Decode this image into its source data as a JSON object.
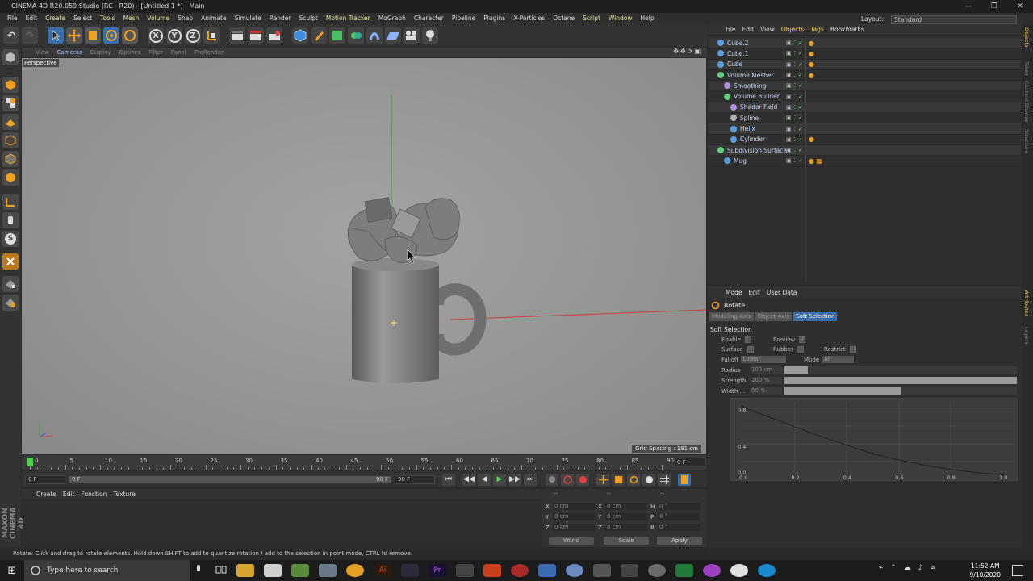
{
  "window": {
    "title": "CINEMA 4D R20.059 Studio (RC - R20) - [Untitled 1 *] - Main",
    "controls": [
      "—",
      "❐",
      "✕"
    ]
  },
  "menubar": {
    "items": [
      "File",
      "Edit",
      "Create",
      "Select",
      "Tools",
      "Mesh",
      "Volume",
      "Snap",
      "Animate",
      "Simulate",
      "Render",
      "Sculpt",
      "Motion Tracker",
      "MoGraph",
      "Character",
      "Pipeline",
      "Plugins",
      "X-Particles",
      "Octane",
      "Script",
      "Window",
      "Help"
    ],
    "highlighted": [
      "Create",
      "Tools",
      "Mesh",
      "Volume",
      "Motion Tracker",
      "Script",
      "Window"
    ],
    "layout_label": "Layout:",
    "layout_value": "Standard"
  },
  "toolbar": {
    "undo_icon": "↶",
    "redo_icon": "↷",
    "x_label": "X",
    "y_label": "Y",
    "z_label": "Z"
  },
  "viewport": {
    "menu": [
      "View",
      "Cameras",
      "Display",
      "Options",
      "Filter",
      "Panel",
      "ProRender"
    ],
    "active_menu": "Cameras",
    "camera_label": "Perspective",
    "grid_spacing": "Grid Spacing : 191 cm",
    "nav_icons": "✥✥⟳▣",
    "accent_background": "#959595"
  },
  "timeline": {
    "ticks": [
      "0",
      "5",
      "10",
      "15",
      "20",
      "25",
      "30",
      "35",
      "40",
      "45",
      "50",
      "55",
      "60",
      "65",
      "70",
      "75",
      "80",
      "85",
      "90"
    ],
    "current_frame_field": "0 F"
  },
  "transport": {
    "start_field": "0 F",
    "slider_start": "0 F",
    "slider_end": "90 F",
    "end_field": "90 F",
    "buttons": [
      "⏮",
      "◀◀",
      "◀",
      "▶",
      "▶▶",
      "⏭"
    ]
  },
  "material_panel": {
    "menu": [
      "Create",
      "Edit",
      "Function",
      "Texture"
    ]
  },
  "coordinates": {
    "headers": [
      "--",
      "--",
      "--"
    ],
    "rows": [
      {
        "a": "X",
        "a_val": "0 cm",
        "b": "X",
        "b_val": "0 cm",
        "c": "H",
        "c_val": "0 °"
      },
      {
        "a": "Y",
        "a_val": "0 cm",
        "b": "Y",
        "b_val": "0 cm",
        "c": "P",
        "c_val": "0 °"
      },
      {
        "a": "Z",
        "a_val": "0 cm",
        "b": "Z",
        "b_val": "0 cm",
        "c": "B",
        "c_val": "0 °"
      }
    ],
    "world_label": "World",
    "scale_label": "Scale",
    "apply_label": "Apply"
  },
  "status": {
    "text": "Rotate: Click and drag to rotate elements. Hold down SHIFT to add to quantize rotation / add to the selection in point mode, CTRL to remove."
  },
  "object_manager": {
    "menu": [
      "File",
      "Edit",
      "View",
      "Objects",
      "Tags",
      "Bookmarks"
    ],
    "objects": [
      {
        "name": "Cube.2",
        "indent": 0,
        "color": "#5aa0e0",
        "tag": "●"
      },
      {
        "name": "Cube.1",
        "indent": 0,
        "color": "#5aa0e0",
        "tag": "●"
      },
      {
        "name": "Cube",
        "indent": 0,
        "color": "#5aa0e0",
        "tag": "●"
      },
      {
        "name": "Volume Mesher",
        "indent": 0,
        "color": "#60d080",
        "tag": "●"
      },
      {
        "name": "Smoothing",
        "indent": 1,
        "color": "#b090e0",
        "tag": ""
      },
      {
        "name": "Volume Builder",
        "indent": 1,
        "color": "#60d080",
        "tag": ""
      },
      {
        "name": "Shader Field",
        "indent": 2,
        "color": "#b090e0",
        "tag": ""
      },
      {
        "name": "Spline",
        "indent": 2,
        "color": "#aaaaaa",
        "tag": ""
      },
      {
        "name": "Helix",
        "indent": 2,
        "color": "#5aa0e0",
        "tag": ""
      },
      {
        "name": "Cylinder",
        "indent": 2,
        "color": "#5aa0e0",
        "tag": "●"
      },
      {
        "name": "Subdivision Surface",
        "indent": 0,
        "color": "#60d080",
        "tag": ""
      },
      {
        "name": "Mug",
        "indent": 1,
        "color": "#5aa0e0",
        "tag": "● ▦"
      }
    ]
  },
  "side_tabs": [
    "Objects",
    "Takes",
    "Content Browser",
    "Structure",
    "Attributes",
    "Layers"
  ],
  "attributes": {
    "menu": [
      "Mode",
      "Edit",
      "User Data"
    ],
    "tool_name": "Rotate",
    "tabs": [
      "Modeling Axis",
      "Object Axis",
      "Soft Selection"
    ],
    "active_tab": "Soft Selection",
    "section": "Soft Selection",
    "enable_label": "Enable",
    "preview_label": "Preview",
    "surface_label": "Surface",
    "rubber_label": "Rubber",
    "restrict_label": "Restrict",
    "falloff_label": "Falloff",
    "falloff_value": "Linear",
    "mode_label": "Mode",
    "mode_value": "All",
    "radius_label": "Radius",
    "radius_value": "100 cm",
    "radius_fill": 0.1,
    "strength_label": "Strength",
    "strength_value": "100 %",
    "strength_fill": 1.0,
    "width_label": "Width . .",
    "width_value": "50 %",
    "width_fill": 0.5,
    "graph_y_labels": [
      "0.8",
      "0.4",
      "0.0"
    ],
    "graph_x_labels": [
      "0.0",
      "0.2",
      "0.4",
      "0.6",
      "0.8",
      "1.0"
    ]
  },
  "taskbar": {
    "search_placeholder": "Type here to search",
    "time": "11:52 AM",
    "date": "9/10/2020"
  }
}
